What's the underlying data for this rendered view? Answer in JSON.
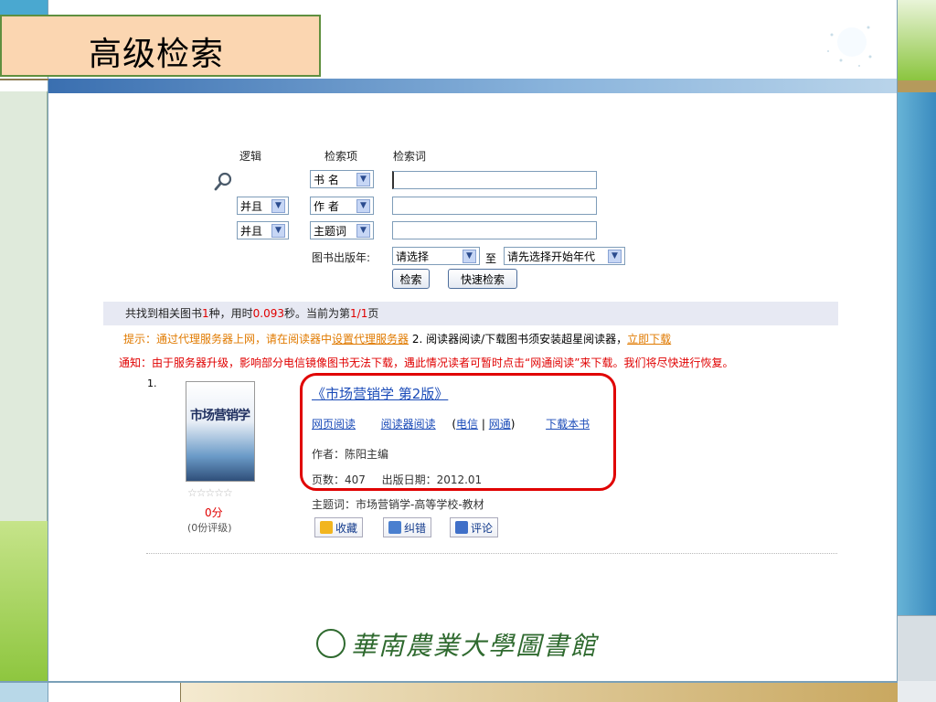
{
  "slide": {
    "title": "高级检索"
  },
  "search": {
    "col_logic": "逻辑",
    "col_field": "检索项",
    "col_term": "检索词",
    "rows": [
      {
        "logic": "",
        "field": "书 名",
        "term": ""
      },
      {
        "logic": "并且",
        "field": "作 者",
        "term": ""
      },
      {
        "logic": "并且",
        "field": "主题词",
        "term": ""
      }
    ],
    "year_label": "图书出版年:",
    "year_from": "请选择",
    "year_to_label": "至",
    "year_to": "请先选择开始年代",
    "search_button": "检索",
    "quick_button": "快速检索"
  },
  "result_summary": {
    "prefix": "共找到相关图书",
    "count": "1",
    "mid1": "种，用时",
    "time": "0.093",
    "mid2": "秒。当前为第",
    "page": "1/1",
    "suffix": "页"
  },
  "tip": {
    "label": "提示：",
    "text1": "通过代理服务器上网，请在阅读器中",
    "link1": "设置代理服务器",
    "text2": " 2. 阅读器阅读/下载图书须安装超星阅读器，",
    "link2": "立即下载"
  },
  "notice": "通知：由于服务器升级，影响部分电信镜像图书无法下载，遇此情况读者可暂时点击“网通阅读”来下载。我们将尽快进行恢复。",
  "book": {
    "index": "1.",
    "cover_title": "市场营销学",
    "title": "《市场营销学 第2版》",
    "read_web": "网页阅读",
    "read_reader": "阅读器阅读",
    "paren_open": "(",
    "telecom": "电信",
    "sep": "|",
    "netcom": "网通",
    "paren_close": ")",
    "download": "下载本书",
    "author": "作者：陈阳主编",
    "pages": "页数：407",
    "pub_date": "出版日期：2012.01",
    "subject": "主题词：市场营销学-高等学校-教材",
    "stars": "☆☆☆☆☆",
    "score": "0分",
    "rating_count": "(0份评级)",
    "actions": {
      "favorite": "收藏",
      "correct": "纠错",
      "comment": "评论"
    }
  },
  "footer": {
    "logo_text": "華南農業大學圖書館"
  },
  "colors": {
    "title_box": "#fbd6b1",
    "red": "#e00000",
    "link": "#1a4bb8",
    "tip": "#e07a00"
  }
}
